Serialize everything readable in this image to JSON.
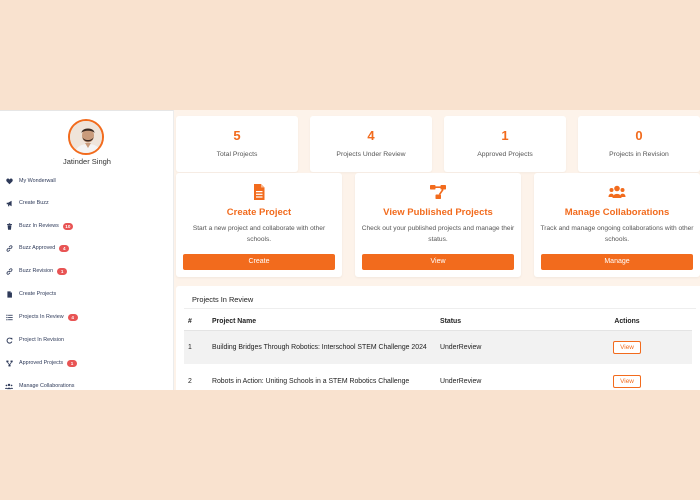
{
  "colors": {
    "accent": "#f26b1d",
    "badge": "#e85454",
    "background": "#f9e2cf"
  },
  "user": {
    "name": "Jatinder Singh"
  },
  "sidebar": {
    "items": [
      {
        "label": "My Wonderwall",
        "icon": "heart-icon",
        "badge": ""
      },
      {
        "label": "Create Buzz",
        "icon": "megaphone-icon",
        "badge": ""
      },
      {
        "label": "Buzz In Reviews",
        "icon": "trash-icon",
        "badge": "10"
      },
      {
        "label": "Buzz Approved",
        "icon": "link-icon",
        "badge": "4"
      },
      {
        "label": "Buzz Revision",
        "icon": "link-icon",
        "badge": "1"
      },
      {
        "label": "Create Projects",
        "icon": "file-icon",
        "badge": ""
      },
      {
        "label": "Projects In Review",
        "icon": "list-icon",
        "badge": "4"
      },
      {
        "label": "Project In Revision",
        "icon": "refresh-icon",
        "badge": ""
      },
      {
        "label": "Approved Projects",
        "icon": "sitemap-icon",
        "badge": "1"
      },
      {
        "label": "Manage Collaborations",
        "icon": "users-icon",
        "badge": ""
      }
    ]
  },
  "stats": [
    {
      "value": "5",
      "label": "Total Projects"
    },
    {
      "value": "4",
      "label": "Projects Under Review"
    },
    {
      "value": "1",
      "label": "Approved Projects"
    },
    {
      "value": "0",
      "label": "Projects in Revision"
    }
  ],
  "actions": [
    {
      "title": "Create Project",
      "description": "Start a new project and collaborate with other schools.",
      "button": "Create",
      "icon": "file-icon"
    },
    {
      "title": "View Published Projects",
      "description": "Check out your published projects and manage their status.",
      "button": "View",
      "icon": "sitemap-icon"
    },
    {
      "title": "Manage Collaborations",
      "description": "Track and manage ongoing collaborations with other schools.",
      "button": "Manage",
      "icon": "users-icon"
    }
  ],
  "review": {
    "title": "Projects In Review",
    "columns": [
      "#",
      "Project Name",
      "Status",
      "Actions"
    ],
    "rows": [
      {
        "num": "1",
        "name": "Building Bridges Through Robotics: Interschool STEM Challenge 2024",
        "status": "UnderReview",
        "action": "View"
      },
      {
        "num": "2",
        "name": "Robots in Action: Uniting Schools in a STEM Robotics Challenge",
        "status": "UnderReview",
        "action": "View"
      }
    ]
  }
}
